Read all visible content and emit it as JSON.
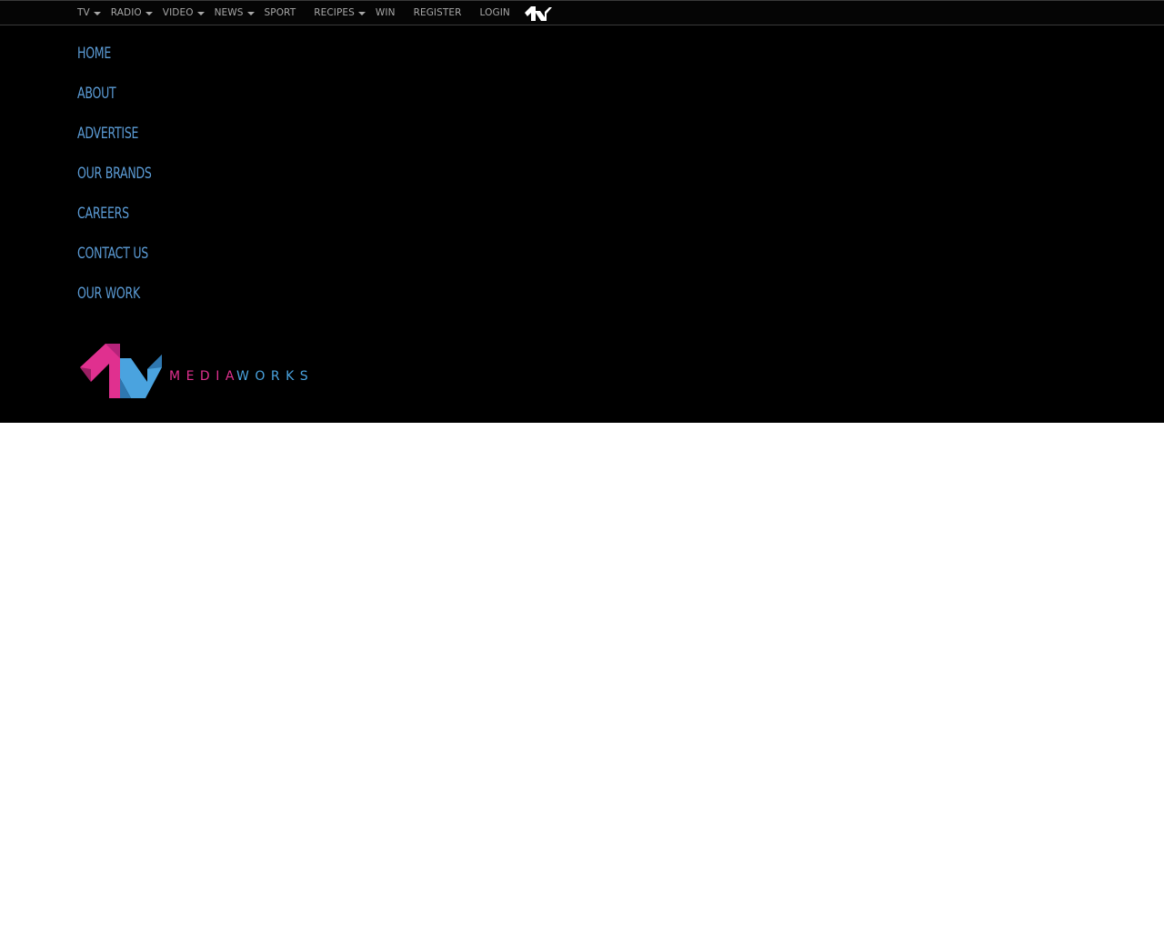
{
  "topnav": {
    "items": [
      {
        "label": "TV",
        "dropdown": true
      },
      {
        "label": "RADIO",
        "dropdown": true
      },
      {
        "label": "VIDEO",
        "dropdown": true
      },
      {
        "label": "NEWS",
        "dropdown": true
      },
      {
        "label": "SPORT",
        "dropdown": false
      },
      {
        "label": "RECIPES",
        "dropdown": true
      },
      {
        "label": "WIN",
        "dropdown": false
      },
      {
        "label": "REGISTER",
        "dropdown": false
      },
      {
        "label": "LOGIN",
        "dropdown": false
      }
    ],
    "brand_icon": "mediaworks-mark-icon"
  },
  "footer": {
    "links": [
      {
        "label": "HOME"
      },
      {
        "label": "ABOUT"
      },
      {
        "label": "ADVERTISE"
      },
      {
        "label": "OUR BRANDS"
      },
      {
        "label": "CAREERS"
      },
      {
        "label": "CONTACT US"
      },
      {
        "label": "OUR WORK"
      }
    ],
    "logo": {
      "text_part1": "MEDIA",
      "text_part2": "WORKS",
      "icon": "mediaworks-logo-icon"
    }
  },
  "colors": {
    "nav_text": "#a8a8a8",
    "footer_link": "#5b9bd5",
    "brand_pink": "#e0308f",
    "brand_blue": "#4aa3df",
    "background_dark": "#000000"
  }
}
